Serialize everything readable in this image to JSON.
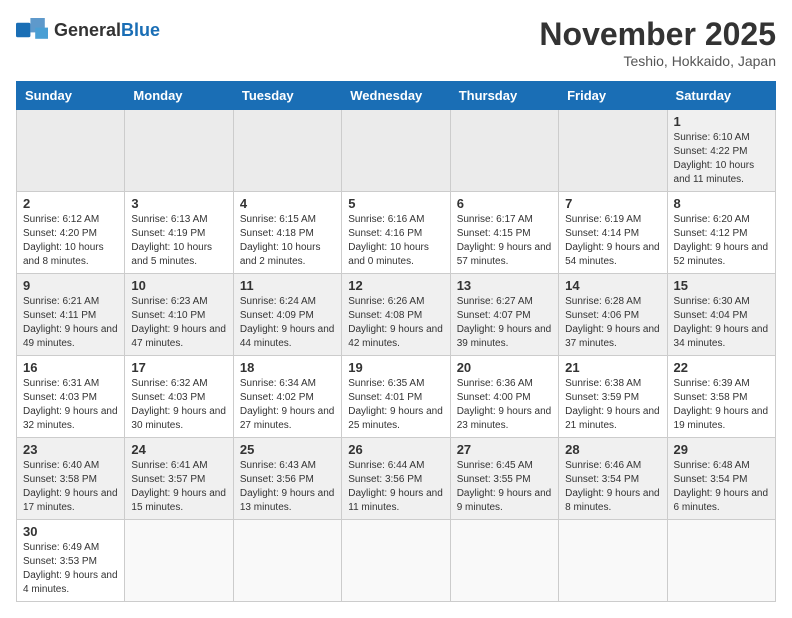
{
  "header": {
    "logo_general": "General",
    "logo_blue": "Blue",
    "month_title": "November 2025",
    "location": "Teshio, Hokkaido, Japan"
  },
  "weekdays": [
    "Sunday",
    "Monday",
    "Tuesday",
    "Wednesday",
    "Thursday",
    "Friday",
    "Saturday"
  ],
  "weeks": [
    [
      {
        "day": "",
        "info": ""
      },
      {
        "day": "",
        "info": ""
      },
      {
        "day": "",
        "info": ""
      },
      {
        "day": "",
        "info": ""
      },
      {
        "day": "",
        "info": ""
      },
      {
        "day": "",
        "info": ""
      },
      {
        "day": "1",
        "info": "Sunrise: 6:10 AM\nSunset: 4:22 PM\nDaylight: 10 hours and 11 minutes."
      }
    ],
    [
      {
        "day": "2",
        "info": "Sunrise: 6:12 AM\nSunset: 4:20 PM\nDaylight: 10 hours and 8 minutes."
      },
      {
        "day": "3",
        "info": "Sunrise: 6:13 AM\nSunset: 4:19 PM\nDaylight: 10 hours and 5 minutes."
      },
      {
        "day": "4",
        "info": "Sunrise: 6:15 AM\nSunset: 4:18 PM\nDaylight: 10 hours and 2 minutes."
      },
      {
        "day": "5",
        "info": "Sunrise: 6:16 AM\nSunset: 4:16 PM\nDaylight: 10 hours and 0 minutes."
      },
      {
        "day": "6",
        "info": "Sunrise: 6:17 AM\nSunset: 4:15 PM\nDaylight: 9 hours and 57 minutes."
      },
      {
        "day": "7",
        "info": "Sunrise: 6:19 AM\nSunset: 4:14 PM\nDaylight: 9 hours and 54 minutes."
      },
      {
        "day": "8",
        "info": "Sunrise: 6:20 AM\nSunset: 4:12 PM\nDaylight: 9 hours and 52 minutes."
      }
    ],
    [
      {
        "day": "9",
        "info": "Sunrise: 6:21 AM\nSunset: 4:11 PM\nDaylight: 9 hours and 49 minutes."
      },
      {
        "day": "10",
        "info": "Sunrise: 6:23 AM\nSunset: 4:10 PM\nDaylight: 9 hours and 47 minutes."
      },
      {
        "day": "11",
        "info": "Sunrise: 6:24 AM\nSunset: 4:09 PM\nDaylight: 9 hours and 44 minutes."
      },
      {
        "day": "12",
        "info": "Sunrise: 6:26 AM\nSunset: 4:08 PM\nDaylight: 9 hours and 42 minutes."
      },
      {
        "day": "13",
        "info": "Sunrise: 6:27 AM\nSunset: 4:07 PM\nDaylight: 9 hours and 39 minutes."
      },
      {
        "day": "14",
        "info": "Sunrise: 6:28 AM\nSunset: 4:06 PM\nDaylight: 9 hours and 37 minutes."
      },
      {
        "day": "15",
        "info": "Sunrise: 6:30 AM\nSunset: 4:04 PM\nDaylight: 9 hours and 34 minutes."
      }
    ],
    [
      {
        "day": "16",
        "info": "Sunrise: 6:31 AM\nSunset: 4:03 PM\nDaylight: 9 hours and 32 minutes."
      },
      {
        "day": "17",
        "info": "Sunrise: 6:32 AM\nSunset: 4:03 PM\nDaylight: 9 hours and 30 minutes."
      },
      {
        "day": "18",
        "info": "Sunrise: 6:34 AM\nSunset: 4:02 PM\nDaylight: 9 hours and 27 minutes."
      },
      {
        "day": "19",
        "info": "Sunrise: 6:35 AM\nSunset: 4:01 PM\nDaylight: 9 hours and 25 minutes."
      },
      {
        "day": "20",
        "info": "Sunrise: 6:36 AM\nSunset: 4:00 PM\nDaylight: 9 hours and 23 minutes."
      },
      {
        "day": "21",
        "info": "Sunrise: 6:38 AM\nSunset: 3:59 PM\nDaylight: 9 hours and 21 minutes."
      },
      {
        "day": "22",
        "info": "Sunrise: 6:39 AM\nSunset: 3:58 PM\nDaylight: 9 hours and 19 minutes."
      }
    ],
    [
      {
        "day": "23",
        "info": "Sunrise: 6:40 AM\nSunset: 3:58 PM\nDaylight: 9 hours and 17 minutes."
      },
      {
        "day": "24",
        "info": "Sunrise: 6:41 AM\nSunset: 3:57 PM\nDaylight: 9 hours and 15 minutes."
      },
      {
        "day": "25",
        "info": "Sunrise: 6:43 AM\nSunset: 3:56 PM\nDaylight: 9 hours and 13 minutes."
      },
      {
        "day": "26",
        "info": "Sunrise: 6:44 AM\nSunset: 3:56 PM\nDaylight: 9 hours and 11 minutes."
      },
      {
        "day": "27",
        "info": "Sunrise: 6:45 AM\nSunset: 3:55 PM\nDaylight: 9 hours and 9 minutes."
      },
      {
        "day": "28",
        "info": "Sunrise: 6:46 AM\nSunset: 3:54 PM\nDaylight: 9 hours and 8 minutes."
      },
      {
        "day": "29",
        "info": "Sunrise: 6:48 AM\nSunset: 3:54 PM\nDaylight: 9 hours and 6 minutes."
      }
    ],
    [
      {
        "day": "30",
        "info": "Sunrise: 6:49 AM\nSunset: 3:53 PM\nDaylight: 9 hours and 4 minutes."
      },
      {
        "day": "",
        "info": ""
      },
      {
        "day": "",
        "info": ""
      },
      {
        "day": "",
        "info": ""
      },
      {
        "day": "",
        "info": ""
      },
      {
        "day": "",
        "info": ""
      },
      {
        "day": "",
        "info": ""
      }
    ]
  ]
}
